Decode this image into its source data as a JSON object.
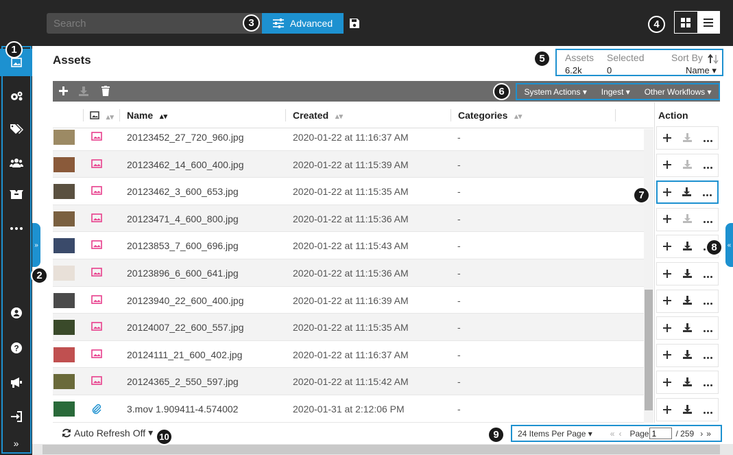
{
  "topbar": {
    "search_placeholder": "Search",
    "advanced_label": "Advanced",
    "save_icon": "floppy-disk-icon",
    "view_modes": [
      "grid",
      "list"
    ]
  },
  "sidebar": {
    "items": [
      {
        "icon": "image-icon",
        "active": true
      },
      {
        "icon": "gears-icon"
      },
      {
        "icon": "tags-icon"
      },
      {
        "icon": "users-icon"
      },
      {
        "icon": "box-icon"
      },
      {
        "icon": "more-icon"
      },
      {
        "icon": "user-circle-icon"
      },
      {
        "icon": "help-icon"
      },
      {
        "icon": "megaphone-icon"
      },
      {
        "icon": "sign-in-icon"
      }
    ],
    "collapse_label": "»"
  },
  "badges": [
    "1",
    "2",
    "3",
    "4",
    "5",
    "6",
    "7",
    "8",
    "9",
    "10"
  ],
  "page": {
    "title": "Assets"
  },
  "stats": {
    "assets_label": "Assets",
    "assets_value": "6.2k",
    "selected_label": "Selected",
    "selected_value": "0",
    "sort_label": "Sort By",
    "sort_value": "Name"
  },
  "toolbar": {
    "workflows": [
      "System Actions",
      "Ingest",
      "Other Workflows"
    ]
  },
  "table": {
    "columns": [
      "Name",
      "Created",
      "Categories"
    ],
    "action_header": "Action",
    "rows": [
      {
        "name": "20123452_27_720_960.jpg",
        "created": "2020-01-22 at 11:16:37 AM",
        "category": "-",
        "type": "image",
        "thumb": "#9c8a64"
      },
      {
        "name": "20123462_14_600_400.jpg",
        "created": "2020-01-22 at 11:15:39 AM",
        "category": "-",
        "type": "image",
        "thumb": "#8a5a3a"
      },
      {
        "name": "20123462_3_600_653.jpg",
        "created": "2020-01-22 at 11:15:35 AM",
        "category": "-",
        "type": "image",
        "thumb": "#5a5040"
      },
      {
        "name": "20123471_4_600_800.jpg",
        "created": "2020-01-22 at 11:15:36 AM",
        "category": "-",
        "type": "image",
        "thumb": "#7a6040"
      },
      {
        "name": "20123853_7_600_696.jpg",
        "created": "2020-01-22 at 11:15:43 AM",
        "category": "-",
        "type": "image",
        "thumb": "#3a4a6a"
      },
      {
        "name": "20123896_6_600_641.jpg",
        "created": "2020-01-22 at 11:15:36 AM",
        "category": "-",
        "type": "image",
        "thumb": "#e8e0d8"
      },
      {
        "name": "20123940_22_600_400.jpg",
        "created": "2020-01-22 at 11:16:39 AM",
        "category": "-",
        "type": "image",
        "thumb": "#4a4a4a"
      },
      {
        "name": "20124007_22_600_557.jpg",
        "created": "2020-01-22 at 11:15:35 AM",
        "category": "-",
        "type": "image",
        "thumb": "#3a4a2a"
      },
      {
        "name": "20124111_21_600_402.jpg",
        "created": "2020-01-22 at 11:16:37 AM",
        "category": "-",
        "type": "image",
        "thumb": "#c05050"
      },
      {
        "name": "20124365_2_550_597.jpg",
        "created": "2020-01-22 at 11:15:42 AM",
        "category": "-",
        "type": "image",
        "thumb": "#6a6a3a"
      },
      {
        "name": "3.mov 1.909411-4.574002",
        "created": "2020-01-31 at 2:12:06 PM",
        "category": "-",
        "type": "attachment",
        "thumb": "#2a6a3a"
      }
    ]
  },
  "footer": {
    "auto_refresh_label": "Auto Refresh",
    "auto_refresh_value": "Off",
    "per_page": "24 Items Per Page",
    "page_label": "Page",
    "page_value": "1",
    "page_total": "/ 259"
  },
  "colors": {
    "accent": "#1d91d0",
    "dark": "#262626",
    "pink": "#e83e8c"
  }
}
